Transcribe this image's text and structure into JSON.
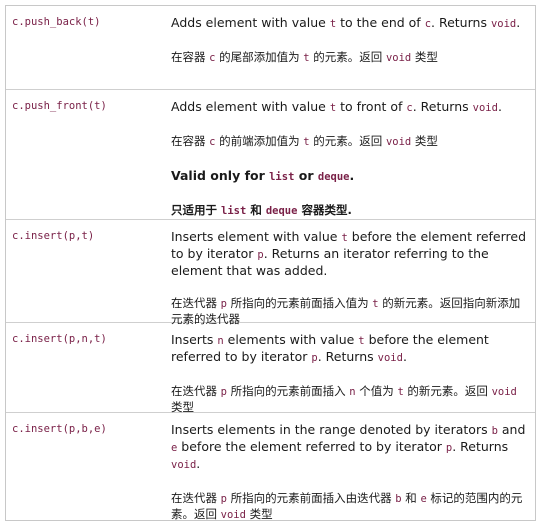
{
  "rows": [
    {
      "code": "c.push_back(t)",
      "en": [
        "Adds element with value ",
        "t",
        " to the end of ",
        "c",
        ". Returns ",
        "void",
        "."
      ],
      "zh": [
        "在容器 ",
        "c",
        " 的尾部添加值为 ",
        "t",
        " 的元素。返回 ",
        "void",
        " 类型"
      ]
    },
    {
      "code": "c.push_front(t)",
      "en": [
        "Adds element with value ",
        "t",
        " to front of ",
        "c",
        ". Returns ",
        "void",
        "."
      ],
      "zh": [
        "在容器 ",
        "c",
        " 的前端添加值为 ",
        "t",
        " 的元素。返回 ",
        "void",
        " 类型"
      ],
      "note_en": [
        "Valid only for ",
        "list",
        " or ",
        "deque",
        "."
      ],
      "note_zh": [
        "只适用于 ",
        "list",
        " 和 ",
        "deque",
        " 容器类型."
      ]
    },
    {
      "code": "c.insert(p,t)",
      "en": [
        "Inserts element with value ",
        "t",
        " before the element referred to by iterator ",
        "p",
        ". Returns an iterator referring to the element that was added."
      ],
      "zh": [
        "在迭代器 ",
        "p",
        " 所指向的元素前面插入值为 ",
        "t",
        " 的新元素。返回指向新添加元素的迭代器"
      ]
    },
    {
      "code": "c.insert(p,n,t)",
      "en": [
        "Inserts ",
        "n",
        " elements with value ",
        "t",
        " before the element referred to by iterator ",
        "p",
        ". Returns ",
        "void",
        "."
      ],
      "zh": [
        "在迭代器 ",
        "p",
        " 所指向的元素前面插入 ",
        "n",
        " 个值为 ",
        "t",
        " 的新元素。返回 ",
        "void",
        " 类型"
      ]
    },
    {
      "code": "c.insert(p,b,e)",
      "en": [
        "Inserts elements in the range denoted by iterators ",
        "b",
        " and ",
        "e",
        " before the element referred to by iterator ",
        "p",
        ". Returns ",
        "void",
        "."
      ],
      "zh": [
        "在迭代器 ",
        "p",
        " 所指向的元素前面插入由迭代器 ",
        "b",
        " 和 ",
        "e",
        " 标记的范围内的元素。返回 ",
        "void",
        " 类型"
      ]
    }
  ]
}
